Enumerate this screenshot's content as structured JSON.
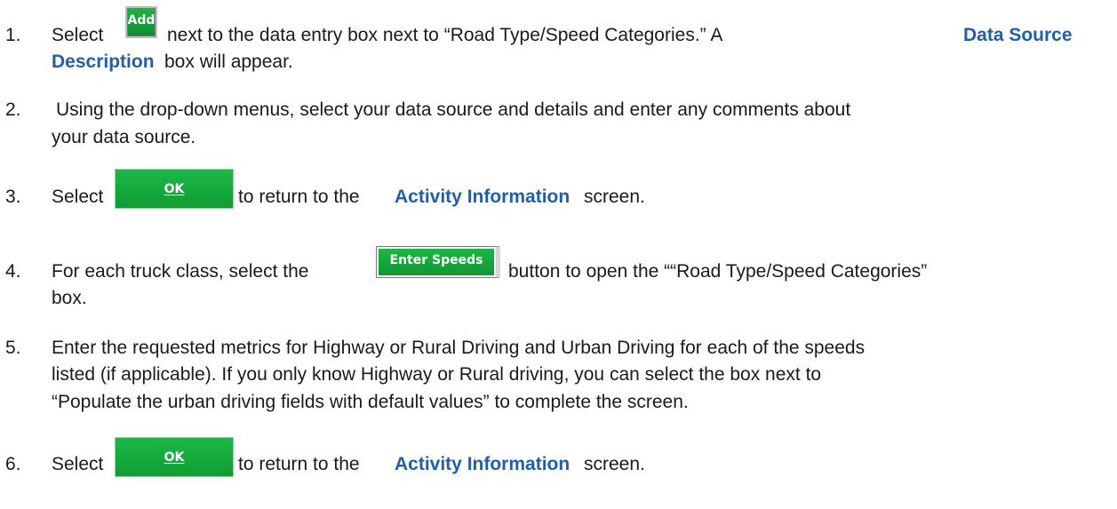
{
  "steps": [
    {
      "num": "1.",
      "line1_pre": "Select",
      "button": "Add",
      "line1_post_a": "next to the data entry box next to “Road Type/Speed Categories.” A",
      "line1_hl": "Data Source",
      "line2_hl": "Description",
      "line2_post": "box will appear."
    },
    {
      "num": "2.",
      "line1": "Using the drop-down menus, select your data source and details and enter any comments about",
      "line2": "your data source."
    },
    {
      "num": "3.",
      "pre": "Select",
      "button": "OK",
      "mid": "to return to the",
      "hl": "Activity Information",
      "post": "screen."
    },
    {
      "num": "4.",
      "pre": "For each truck class, select the",
      "button": "Enter Speeds",
      "post": "button to open the ““Road Type/Speed Categories”",
      "line2": "box."
    },
    {
      "num": "5.",
      "line1": "Enter the requested metrics for Highway or Rural Driving and Urban Driving for each of the speeds",
      "line2": "listed (if applicable).  If you only know Highway or Rural driving, you can select the box next to",
      "line3": "“Populate the urban driving fields with default values” to complete the screen."
    },
    {
      "num": "6.",
      "pre": "Select",
      "button": "OK",
      "mid": "to return to the",
      "hl": "Activity Information",
      "post": "screen."
    }
  ],
  "colors": {
    "highlight": "#1f5fa8",
    "button_green": "#14a83a"
  }
}
